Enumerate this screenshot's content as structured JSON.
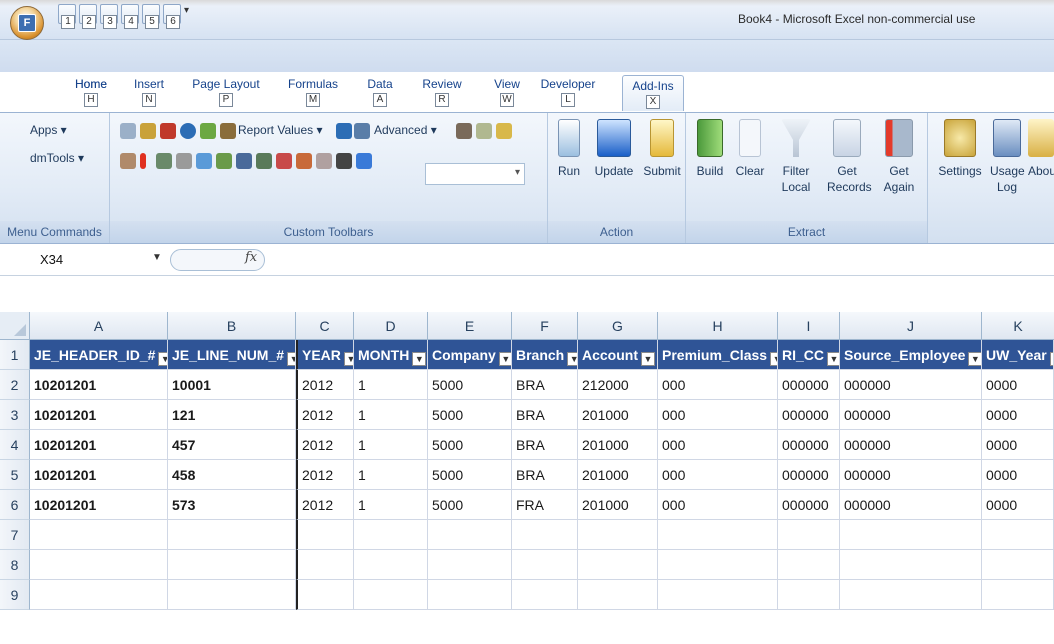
{
  "window": {
    "title": "Book4 - Microsoft Excel non-commercial use"
  },
  "office_button": {
    "key": "F"
  },
  "quick_access": {
    "keys": [
      "1",
      "2",
      "3",
      "4",
      "5",
      "6"
    ]
  },
  "tabs": [
    {
      "label": "Home",
      "key": "H"
    },
    {
      "label": "Insert",
      "key": "N"
    },
    {
      "label": "Page Layout",
      "key": "P"
    },
    {
      "label": "Formulas",
      "key": "M"
    },
    {
      "label": "Data",
      "key": "A"
    },
    {
      "label": "Review",
      "key": "R"
    },
    {
      "label": "View",
      "key": "W"
    },
    {
      "label": "Developer",
      "key": "L"
    },
    {
      "label": "Add-Ins",
      "key": "X"
    }
  ],
  "ribbon": {
    "menu_commands": {
      "label": "Menu Commands",
      "items": [
        "Apps ▾",
        "dmTools ▾"
      ]
    },
    "custom_toolbars": {
      "label": "Custom Toolbars",
      "report_values": "Report Values ▾",
      "advanced": "Advanced ▾"
    },
    "action": {
      "label": "Action",
      "buttons": [
        "Run",
        "Update",
        "Submit"
      ]
    },
    "extract": {
      "label": "Extract",
      "buttons": [
        "Build",
        "Clear",
        "Filter Local",
        "Get Records",
        "Get Again"
      ]
    },
    "settings": {
      "buttons": [
        "Settings",
        "Usage Log",
        "Abou"
      ]
    }
  },
  "formula_bar": {
    "name_box": "X34",
    "fx": "fx",
    "value": ""
  },
  "sheet": {
    "columns": [
      "A",
      "B",
      "C",
      "D",
      "E",
      "F",
      "G",
      "H",
      "I",
      "J",
      "K"
    ],
    "row_numbers": [
      "1",
      "2",
      "3",
      "4",
      "5",
      "6",
      "7",
      "8",
      "9"
    ],
    "headers": [
      "JE_HEADER_ID_#",
      "JE_LINE_NUM_#",
      "YEAR",
      "MONTH",
      "Company",
      "Branch",
      "Account",
      "Premium_Class",
      "RI_CC",
      "Source_Employee",
      "UW_Year"
    ],
    "rows": [
      [
        "10201201",
        "10001",
        "2012",
        "1",
        "5000",
        "BRA",
        "212000",
        "000",
        "000000",
        "000000",
        "0000"
      ],
      [
        "10201201",
        "121",
        "2012",
        "1",
        "5000",
        "BRA",
        "201000",
        "000",
        "000000",
        "000000",
        "0000"
      ],
      [
        "10201201",
        "457",
        "2012",
        "1",
        "5000",
        "BRA",
        "201000",
        "000",
        "000000",
        "000000",
        "0000"
      ],
      [
        "10201201",
        "458",
        "2012",
        "1",
        "5000",
        "BRA",
        "201000",
        "000",
        "000000",
        "000000",
        "0000"
      ],
      [
        "10201201",
        "573",
        "2012",
        "1",
        "5000",
        "FRA",
        "201000",
        "000",
        "000000",
        "000000",
        "0000"
      ]
    ]
  }
}
